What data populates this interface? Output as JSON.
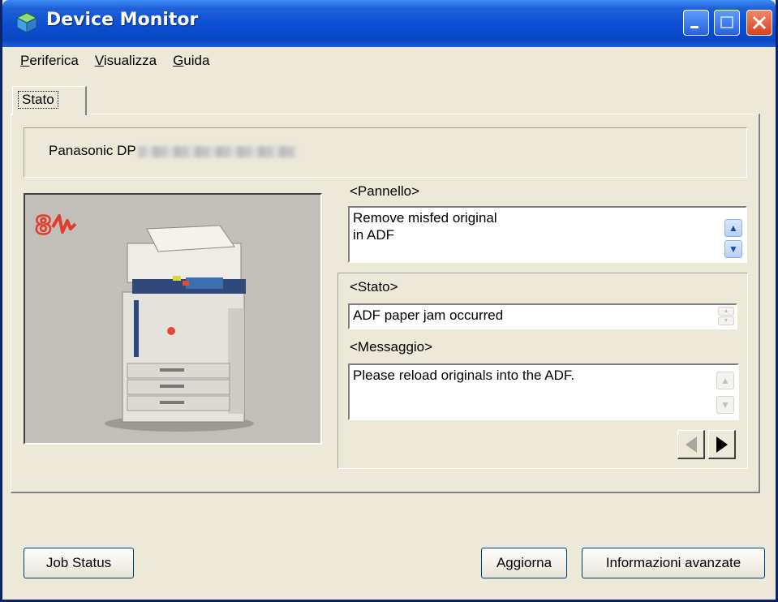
{
  "window": {
    "title": "Device Monitor"
  },
  "menu": {
    "items": [
      "Periferica",
      "Visualizza",
      "Guida"
    ]
  },
  "tabs": {
    "active": "Stato"
  },
  "device": {
    "name_prefix": "Panasonic DP"
  },
  "panel": {
    "label": "<Pannello>",
    "line1": "Remove misfed original",
    "line2": "in ADF"
  },
  "status": {
    "label": "<Stato>",
    "value": "ADF paper jam occurred"
  },
  "message": {
    "label": "<Messaggio>",
    "value": "Please reload originals into the ADF."
  },
  "buttons": {
    "job_status": "Job Status",
    "refresh": "Aggiorna",
    "advanced": "Informazioni avanzate"
  },
  "colors": {
    "title_blue": "#0b4fd1",
    "error_icon": "#e23b2a",
    "window_face": "#ece9d8"
  }
}
